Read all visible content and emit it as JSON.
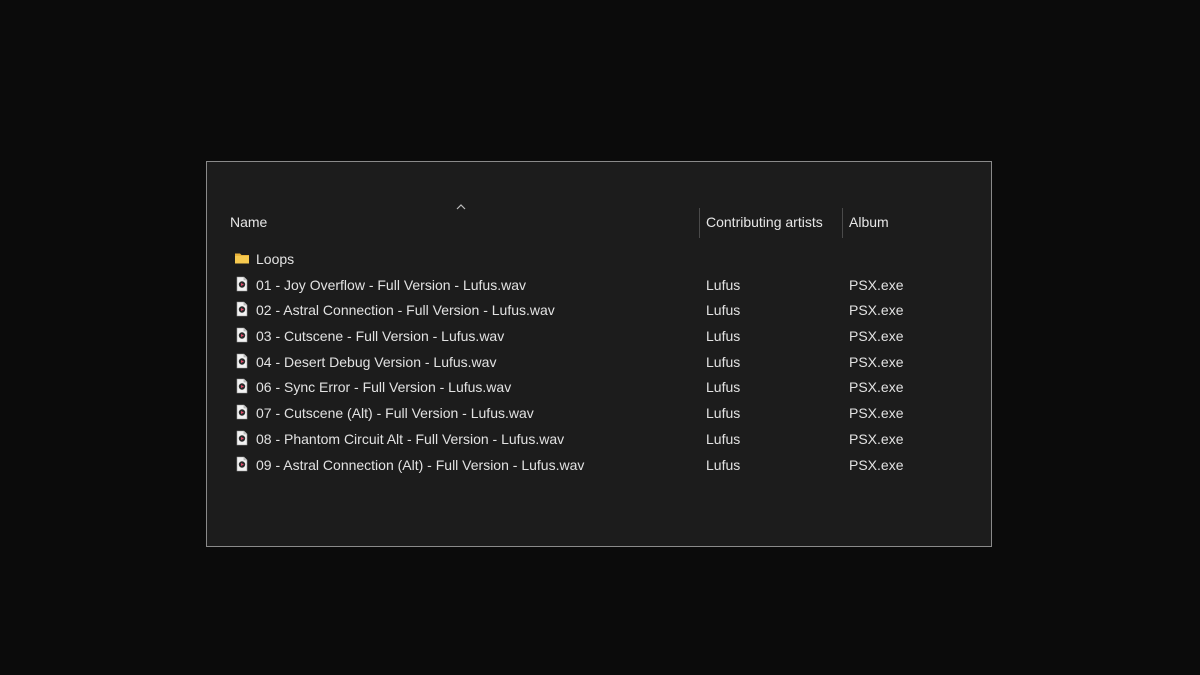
{
  "columns": {
    "name": "Name",
    "artist": "Contributing artists",
    "album": "Album"
  },
  "folder": {
    "name": "Loops",
    "icon": "folder-icon",
    "color": "#f2c14e"
  },
  "files": [
    {
      "name": "01 - Joy Overflow - Full Version - Lufus.wav",
      "artist": "Lufus",
      "album": "PSX.exe",
      "icon": "audio-file-icon"
    },
    {
      "name": "02 - Astral Connection - Full Version - Lufus.wav",
      "artist": "Lufus",
      "album": "PSX.exe",
      "icon": "audio-file-icon"
    },
    {
      "name": "03 - Cutscene - Full Version - Lufus.wav",
      "artist": "Lufus",
      "album": "PSX.exe",
      "icon": "audio-file-icon"
    },
    {
      "name": "04 - Desert Debug Version - Lufus.wav",
      "artist": "Lufus",
      "album": "PSX.exe",
      "icon": "audio-file-icon"
    },
    {
      "name": "06 - Sync Error - Full Version - Lufus.wav",
      "artist": "Lufus",
      "album": "PSX.exe",
      "icon": "audio-file-icon"
    },
    {
      "name": "07 - Cutscene (Alt) - Full Version - Lufus.wav",
      "artist": "Lufus",
      "album": "PSX.exe",
      "icon": "audio-file-icon"
    },
    {
      "name": "08 - Phantom Circuit Alt - Full Version - Lufus.wav",
      "artist": "Lufus",
      "album": "PSX.exe",
      "icon": "audio-file-icon"
    },
    {
      "name": "09 - Astral Connection (Alt) - Full Version - Lufus.wav",
      "artist": "Lufus",
      "album": "PSX.exe",
      "icon": "audio-file-icon"
    }
  ],
  "sort": {
    "column": "name",
    "direction": "ascending",
    "icon": "sort-ascending-icon"
  }
}
